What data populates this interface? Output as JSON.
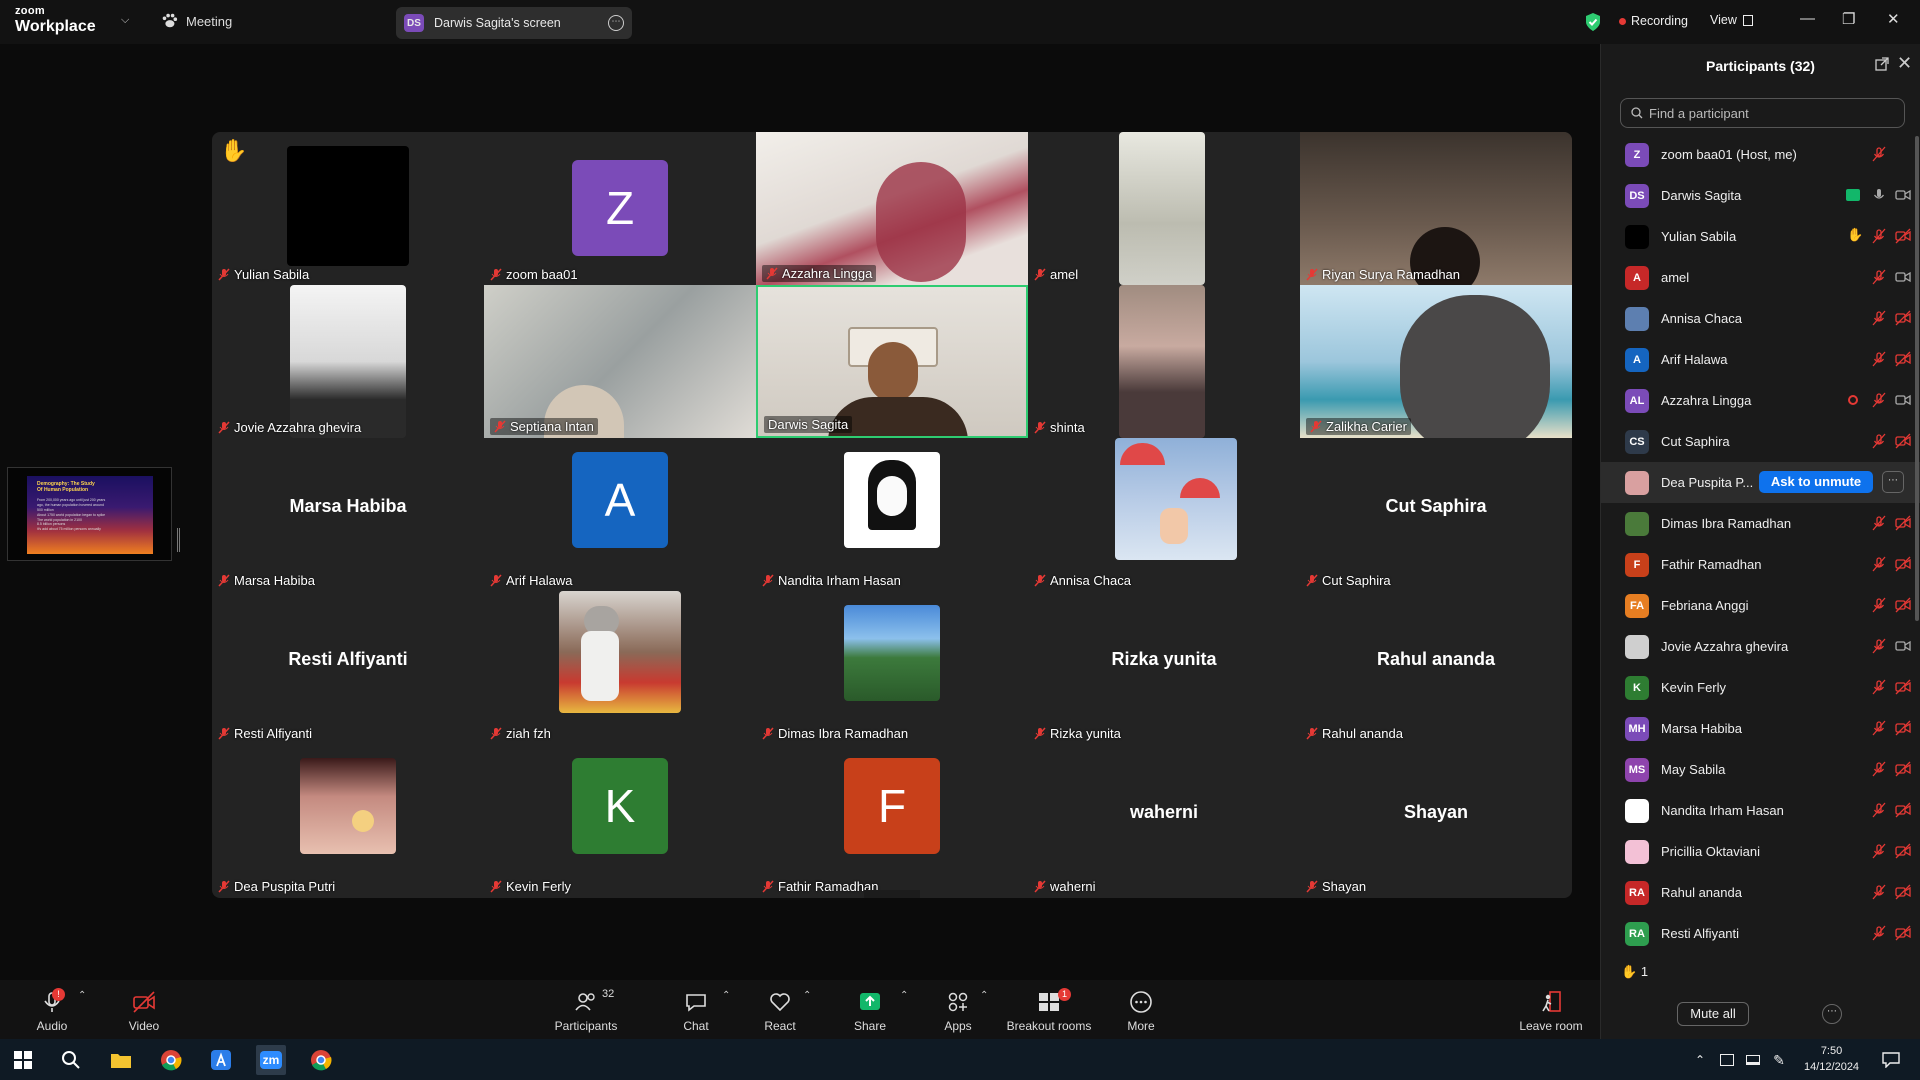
{
  "app": {
    "brand_top": "zoom",
    "brand_bottom": "Workplace"
  },
  "topbar": {
    "meeting_label": "Meeting",
    "share_initials": "DS",
    "share_label": "Darwis Sagita's screen",
    "recording_label": "Recording",
    "view_label": "View"
  },
  "gallery": {
    "tiles": [
      {
        "name": "Yulian Sabila",
        "type": "black"
      },
      {
        "name": "zoom baa01",
        "type": "avatar",
        "letter": "Z"
      },
      {
        "name": "Azzahra Lingga",
        "type": "video"
      },
      {
        "name": "amel",
        "type": "video"
      },
      {
        "name": "Riyan Surya Ramadhan",
        "type": "video"
      },
      {
        "name": "Jovie Azzahra ghevira",
        "type": "video"
      },
      {
        "name": "Septiana Intan",
        "type": "video"
      },
      {
        "name": "Darwis Sagita",
        "type": "video",
        "speaking": true
      },
      {
        "name": "shinta",
        "type": "video"
      },
      {
        "name": "Zalikha Carier",
        "type": "video"
      },
      {
        "name": "Marsa Habiba",
        "type": "text"
      },
      {
        "name": "Arif Halawa",
        "type": "avatar",
        "letter": "A"
      },
      {
        "name": "Nandita Irham Hasan",
        "type": "photo"
      },
      {
        "name": "Annisa Chaca",
        "type": "photo"
      },
      {
        "name": "Cut Saphira",
        "type": "text"
      },
      {
        "name": "Resti Alfiyanti",
        "type": "text"
      },
      {
        "name": "ziah fzh",
        "type": "photo"
      },
      {
        "name": "Dimas Ibra Ramadhan",
        "type": "photo"
      },
      {
        "name": "Rizka yunita",
        "type": "text"
      },
      {
        "name": "Rahul ananda",
        "type": "text"
      },
      {
        "name": "Dea Puspita Putri",
        "type": "photo"
      },
      {
        "name": "Kevin Ferly",
        "type": "avatar",
        "letter": "K"
      },
      {
        "name": "Fathir Ramadhan",
        "type": "avatar",
        "letter": "F"
      },
      {
        "name": "waherni",
        "type": "text"
      },
      {
        "name": "Shayan",
        "type": "text"
      }
    ]
  },
  "shared_slide": {
    "title": "Demography: The Study Of Human Population",
    "bullets": [
      "From 200,000 years ago until just 200 years ago, the human population hovered around 500 million",
      "About 1750 world population began to spike",
      "The world population in 2100",
      "8.5 billion persons",
      "it's add about 75 million persons annually"
    ]
  },
  "participants_panel": {
    "title": "Participants (32)",
    "search_placeholder": "Find a participant",
    "participants": [
      {
        "initials": "Z",
        "name": "zoom baa01 (Host, me)",
        "color": "#7b4bb8"
      },
      {
        "initials": "DS",
        "name": "Darwis Sagita",
        "color": "#7b4bb8"
      },
      {
        "initials": "",
        "name": "Yulian Sabila",
        "color": "#000000"
      },
      {
        "initials": "A",
        "name": "amel",
        "color": "#c62828"
      },
      {
        "initials": "",
        "name": "Annisa Chaca",
        "color": "#5d7fb0"
      },
      {
        "initials": "A",
        "name": "Arif Halawa",
        "color": "#1565c0"
      },
      {
        "initials": "AL",
        "name": "Azzahra Lingga",
        "color": "#7b4bb8"
      },
      {
        "initials": "CS",
        "name": "Cut Saphira",
        "color": "#2e3a4a"
      },
      {
        "initials": "",
        "name": "Dea Puspita P...",
        "color": "#d9a0a0"
      },
      {
        "initials": "",
        "name": "Dimas Ibra Ramadhan",
        "color": "#4a7a3a"
      },
      {
        "initials": "F",
        "name": "Fathir Ramadhan",
        "color": "#c8401a"
      },
      {
        "initials": "FA",
        "name": "Febriana Anggi",
        "color": "#e67e22"
      },
      {
        "initials": "",
        "name": "Jovie Azzahra ghevira",
        "color": "#cfcfcf"
      },
      {
        "initials": "K",
        "name": "Kevin Ferly",
        "color": "#2e7d32"
      },
      {
        "initials": "MH",
        "name": "Marsa Habiba",
        "color": "#7b4bb8"
      },
      {
        "initials": "MS",
        "name": "May Sabila",
        "color": "#8e44ad"
      },
      {
        "initials": "",
        "name": "Nandita Irham Hasan",
        "color": "#ffffff"
      },
      {
        "initials": "",
        "name": "Pricillia Oktaviani",
        "color": "#f3c1d6"
      },
      {
        "initials": "RA",
        "name": "Rahul ananda",
        "color": "#c62828"
      },
      {
        "initials": "RA",
        "name": "Resti Alfiyanti",
        "color": "#2e9e4f"
      }
    ],
    "ask_to_unmute_label": "Ask to unmute",
    "raised_hand_count": "1",
    "mute_all_label": "Mute all"
  },
  "toolbar": {
    "audio": "Audio",
    "video": "Video",
    "participants": "Participants",
    "participants_count": "32",
    "chat": "Chat",
    "react": "React",
    "share": "Share",
    "apps": "Apps",
    "breakout": "Breakout rooms",
    "breakout_badge": "1",
    "more": "More",
    "leave": "Leave room"
  },
  "taskbar": {
    "time": "7:50",
    "date": "14/12/2024",
    "zoom_label": "zm"
  },
  "colors": {
    "accent": "#0e72ed",
    "active_speaker": "#2ecc71",
    "mute_red": "#e53935"
  }
}
